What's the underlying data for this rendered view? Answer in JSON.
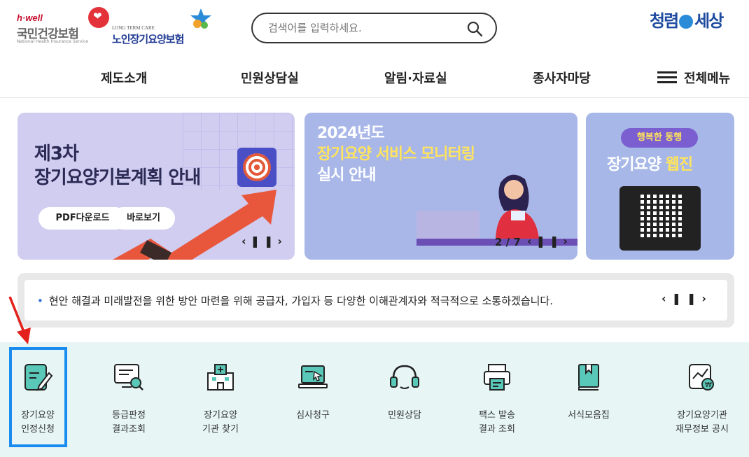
{
  "header": {
    "nhis_logo": {
      "brand": "h·well",
      "name": "국민건강보험",
      "eng": "National Health Insurance Service"
    },
    "ltc_logo": {
      "eng": "LONG TERM CARE",
      "name": "노인장기요양보험"
    },
    "search": {
      "placeholder": "검색어를 입력하세요.",
      "icon": "search-icon"
    },
    "right_logo": {
      "text_a": "청렴",
      "text_b": "세상"
    }
  },
  "nav": {
    "items": [
      "제도소개",
      "민원상담실",
      "알림·자료실",
      "종사자마당"
    ],
    "all_menu": "전체메뉴"
  },
  "banners": {
    "b1": {
      "line1": "제3차",
      "line2": "장기요양기본계획 안내",
      "pdf_button": "PDF다운로드",
      "view_button": "바로보기"
    },
    "b2": {
      "line1": "2024년도",
      "line2": "장기요양 서비스 모니터링",
      "line3": "실시 안내",
      "counter": "2 / 7"
    },
    "b3": {
      "pill": "행복한 동행",
      "title_a": "장기요양 ",
      "title_b": "웹진"
    }
  },
  "notice": {
    "text": "현안 해결과 미래발전을 위한 방안 마련을 위해 공급자, 가입자 등 다양한 이해관계자와 적극적으로 소통하겠습니다."
  },
  "quick_menu": [
    {
      "label": "장기요양\n인정신청",
      "icon": "application-form-icon"
    },
    {
      "label": "등급판정\n결과조회",
      "icon": "monitor-search-icon"
    },
    {
      "label": "장기요양\n기관 찾기",
      "icon": "hospital-building-icon"
    },
    {
      "label": "심사청구",
      "icon": "laptop-cursor-icon"
    },
    {
      "label": "민원상담",
      "icon": "headset-icon"
    },
    {
      "label": "팩스 발송\n결과 조회",
      "icon": "fax-icon"
    },
    {
      "label": "서식모음집",
      "icon": "book-icon"
    },
    {
      "label": "장기요양기관\n재무정보 공시",
      "icon": "finance-chart-icon"
    }
  ],
  "colors": {
    "accent_teal": "#5ac8b8",
    "highlight_blue": "#1a8cf0",
    "annotation_red": "#e3201b",
    "brand_blue": "#1f3a93"
  }
}
